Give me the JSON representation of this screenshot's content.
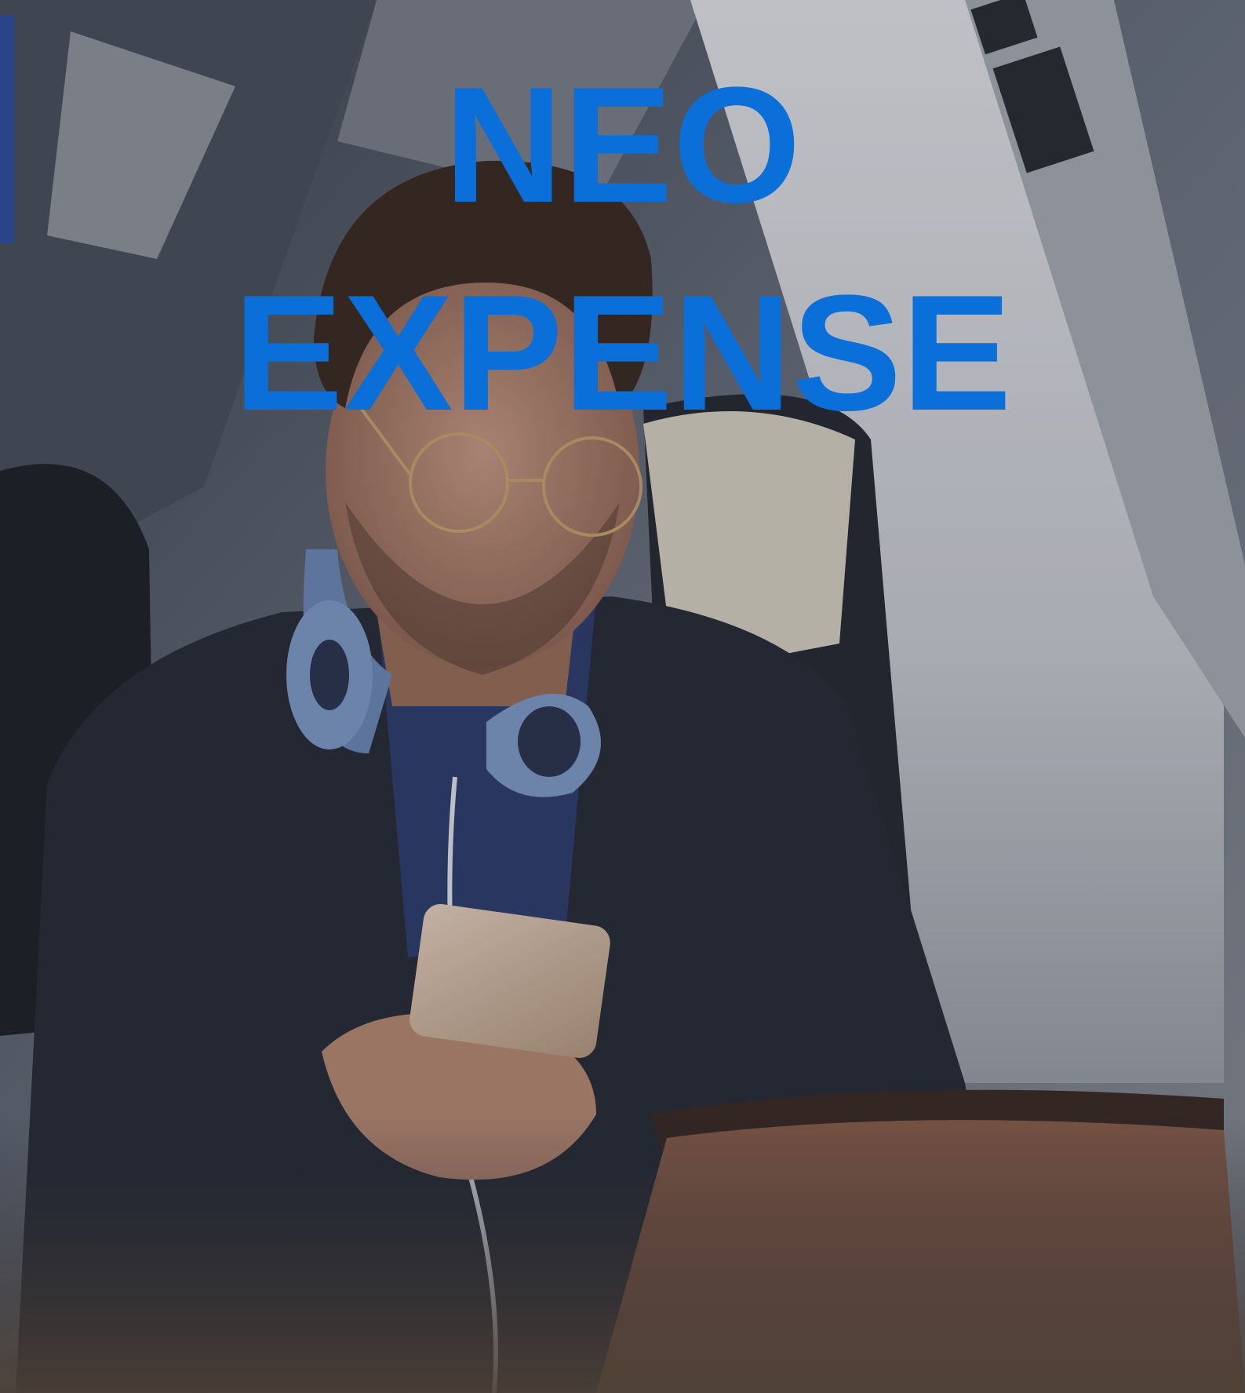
{
  "hero": {
    "title_line1": "NEO",
    "title_line2": "EXPENSE",
    "title_color": "#0a6fd8"
  },
  "photo": {
    "subject": "photo-man-on-train-with-phone-and-tablet"
  }
}
